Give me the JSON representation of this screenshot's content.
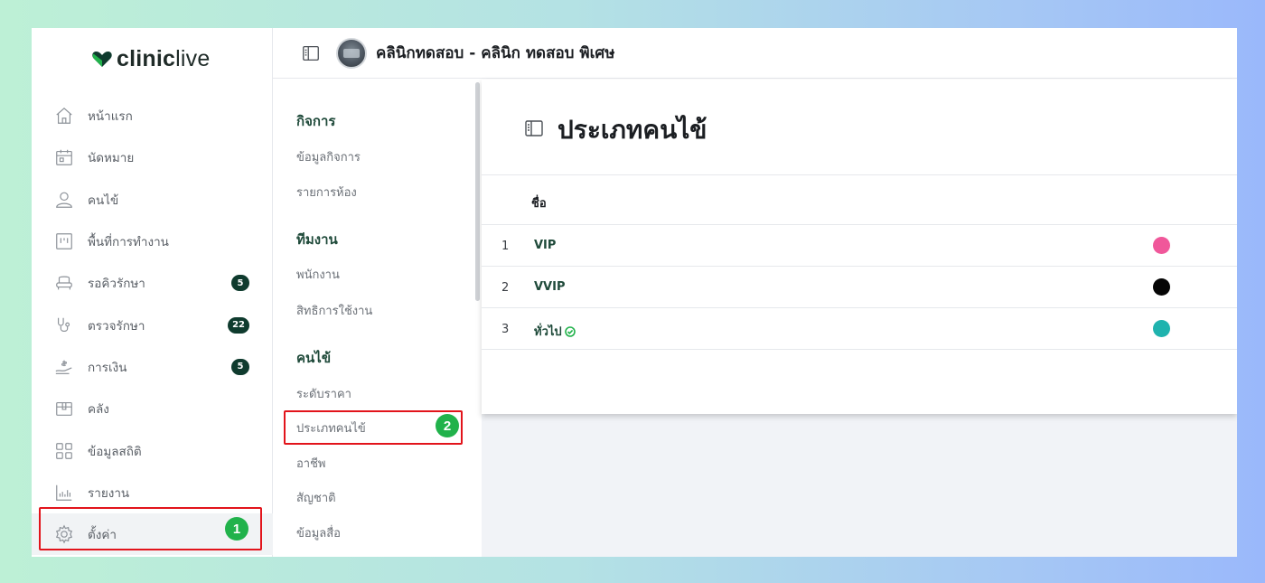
{
  "brand": {
    "logo_text_bold": "clinic",
    "logo_text_light": "live",
    "logo_color": "#0f3b2e"
  },
  "sidebar": {
    "items": [
      {
        "label": "หน้าแรก",
        "icon": "home-icon"
      },
      {
        "label": "นัดหมาย",
        "icon": "calendar-icon"
      },
      {
        "label": "คนไข้",
        "icon": "user-icon"
      },
      {
        "label": "พื้นที่การทำงาน",
        "icon": "workspace-icon"
      },
      {
        "label": "รอคิวรักษา",
        "icon": "chair-icon",
        "badge": "5"
      },
      {
        "label": "ตรวจรักษา",
        "icon": "stethoscope-icon",
        "badge": "22"
      },
      {
        "label": "การเงิน",
        "icon": "money-icon",
        "badge": "5"
      },
      {
        "label": "คลัง",
        "icon": "box-icon"
      },
      {
        "label": "ข้อมูลสถิติ",
        "icon": "grid-icon"
      },
      {
        "label": "รายงาน",
        "icon": "chart-icon"
      },
      {
        "label": "ตั้งค่า",
        "icon": "gear-icon"
      }
    ]
  },
  "header": {
    "clinic_name": "คลินิกทดสอบ - คลินิก ทดสอบ พิเศษ"
  },
  "submenu": {
    "groups": [
      {
        "title": "กิจการ",
        "items": [
          "ข้อมูลกิจการ",
          "รายการห้อง"
        ]
      },
      {
        "title": "ทีมงาน",
        "items": [
          "พนักงาน",
          "สิทธิการใช้งาน"
        ]
      },
      {
        "title": "คนไข้",
        "items": [
          "ระดับราคา",
          "ประเภทคนไข้",
          "อาชีพ",
          "สัญชาติ",
          "ข้อมูลสื่อ"
        ]
      }
    ]
  },
  "page": {
    "title": "ประเภทคนไข้",
    "table": {
      "column_name": "ชื่อ",
      "rows": [
        {
          "index": "1",
          "name": "VIP",
          "color": "#f0579a",
          "default": false
        },
        {
          "index": "2",
          "name": "VVIP",
          "color": "#050505",
          "default": false
        },
        {
          "index": "3",
          "name": "ทั่วไป",
          "color": "#1fb3ae",
          "default": true
        }
      ]
    }
  },
  "annotations": {
    "step1": "1",
    "step2": "2",
    "highlight_color": "#e2141b",
    "step_color": "#21b24b"
  }
}
